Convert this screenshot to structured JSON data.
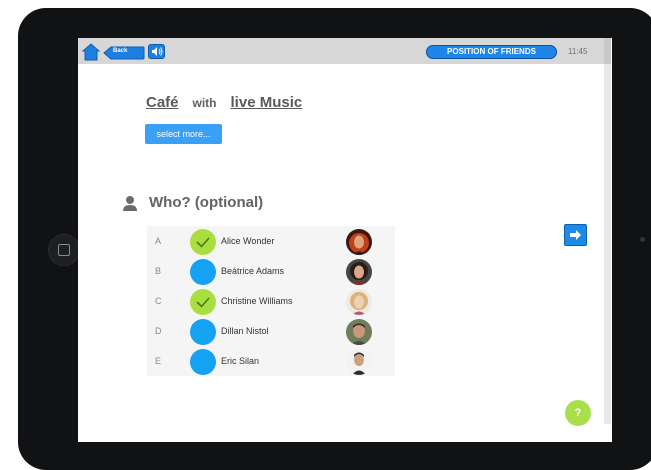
{
  "topbar": {
    "back_label": "Back",
    "friends_button_label": "POSITION OF FRIENDS",
    "time": "11:45"
  },
  "filter": {
    "place": "Café",
    "connector": "with",
    "feature": "live Music",
    "select_more_label": "select more..."
  },
  "who": {
    "title": "Who? (optional)"
  },
  "friends": [
    {
      "letter": "A",
      "name": "Alice Wonder",
      "selected": true
    },
    {
      "letter": "B",
      "name": "Beátrice Adams",
      "selected": false
    },
    {
      "letter": "C",
      "name": "Christine Williams",
      "selected": true
    },
    {
      "letter": "D",
      "name": "Dillan Nistol",
      "selected": false
    },
    {
      "letter": "E",
      "name": "Eric Silan",
      "selected": false
    }
  ],
  "help_label": "?",
  "colors": {
    "accent_blue": "#1e86e8",
    "check_green": "#a8df3e"
  }
}
